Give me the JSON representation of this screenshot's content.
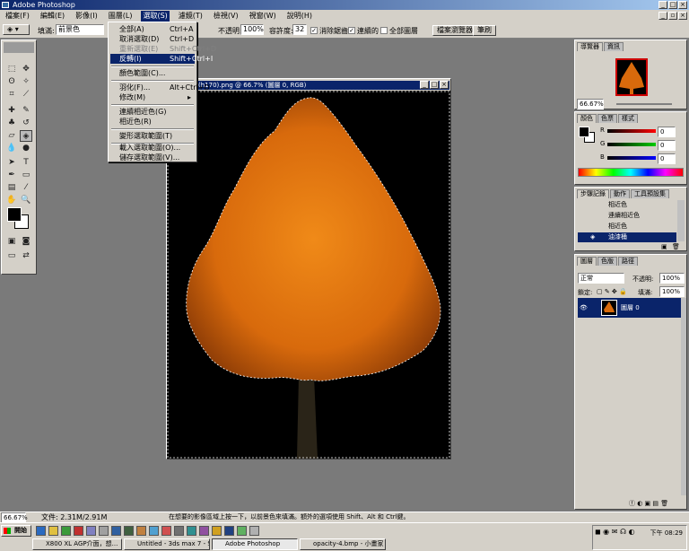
{
  "app": {
    "title": "Adobe Photoshop"
  },
  "menubar": {
    "items": [
      "檔案(F)",
      "編輯(E)",
      "影像(I)",
      "圖層(L)",
      "選取(S)",
      "濾鏡(T)",
      "檢視(V)",
      "視窗(W)",
      "說明(H)"
    ],
    "active_index": 4
  },
  "options_bar": {
    "mode_label": "填滿:",
    "mode_value": "前景色",
    "opacity_label": "不透明:",
    "opacity_value": "100%",
    "tolerance_label": "容許度:",
    "tolerance_value": "32",
    "antialias_label": "消除鋸齒",
    "contiguous_label": "連續的",
    "all_layers_label": "全部圖層",
    "file_browser_tab": "檔案瀏覽器",
    "brushes_tab": "筆刷"
  },
  "select_menu": {
    "items": [
      {
        "label": "全部(A)",
        "shortcut": "Ctrl+A",
        "disabled": false
      },
      {
        "label": "取消選取(D)",
        "shortcut": "Ctrl+D",
        "disabled": false
      },
      {
        "label": "重新選取(E)",
        "shortcut": "Shift+Ctrl+D",
        "disabled": true
      },
      {
        "label": "反轉(I)",
        "shortcut": "Shift+Ctrl+I",
        "highlighted": true
      },
      {
        "label": "顏色範圍(C)...",
        "shortcut": ""
      },
      {
        "label": "羽化(F)...",
        "shortcut": "Alt+Ctrl+D"
      },
      {
        "label": "修改(M)",
        "shortcut": "▸"
      },
      {
        "label": "連續相近色(G)",
        "shortcut": ""
      },
      {
        "label": "相近色(R)",
        "shortcut": ""
      },
      {
        "label": "變形選取範圍(T)",
        "shortcut": ""
      },
      {
        "label": "載入選取範圍(O)...",
        "shortcut": ""
      },
      {
        "label": "儲存選取範圍(V)...",
        "shortcut": ""
      }
    ]
  },
  "document": {
    "title": "(h170).png @ 66.7% (圖層 0, RGB)"
  },
  "navigator": {
    "tabs": [
      "導覽器",
      "資訊"
    ],
    "zoom": "66.67%"
  },
  "color_panel": {
    "tabs": [
      "顏色",
      "色票",
      "樣式"
    ],
    "channels": [
      {
        "name": "R",
        "value": "0",
        "color": "#cc0000"
      },
      {
        "name": "G",
        "value": "0",
        "color": "#00aa00"
      },
      {
        "name": "B",
        "value": "0",
        "color": "#0000cc"
      }
    ]
  },
  "history_panel": {
    "tabs": [
      "步驟記錄",
      "動作",
      "工具預設集"
    ],
    "items": [
      {
        "label": "相近色",
        "active": false
      },
      {
        "label": "連續相近色",
        "active": false
      },
      {
        "label": "相近色",
        "active": false
      },
      {
        "label": "油漆桶",
        "active": true
      }
    ]
  },
  "layers_panel": {
    "tabs": [
      "圖層",
      "色版",
      "路徑"
    ],
    "blend_mode": "正常",
    "opacity_label": "不透明:",
    "opacity_value": "100%",
    "lock_label": "鎖定:",
    "fill_label": "填滿:",
    "fill_value": "100%",
    "layers": [
      {
        "name": "圖層 0",
        "active": true
      }
    ]
  },
  "status_bar": {
    "zoom": "66.67%",
    "doc_info": "文件: 2.31M/2.91M",
    "hint": "在想要的影像區域上按一下，以前景色來填滿。額外的選項使用 Shift、Alt 和 Ctrl鍵。"
  },
  "taskbar": {
    "start_label": "開始",
    "clock": "下午 08:29",
    "buttons": [
      {
        "label": "X800 XL AGP介面，想...",
        "pressed": false
      },
      {
        "label": "Untitled - 3ds max 7 - Str...",
        "pressed": false
      },
      {
        "label": "Adobe Photoshop",
        "pressed": true
      },
      {
        "label": "opacity-4.bmp - 小畫家",
        "pressed": false
      }
    ]
  },
  "colors": {
    "titlebar": "#0a246a",
    "highlight": "#0a246a",
    "chrome": "#d4d0c8",
    "workspace": "#7a7a7a",
    "canvas": "#000000",
    "foliage": "#e07010"
  }
}
